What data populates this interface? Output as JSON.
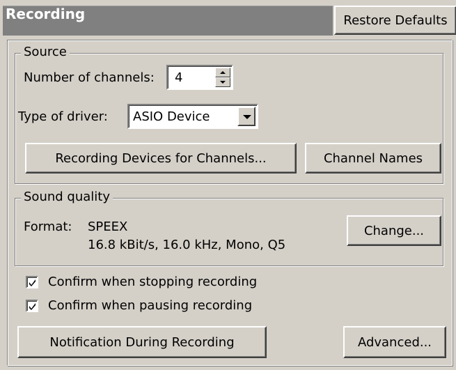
{
  "header": {
    "title": "Recording",
    "restore_defaults_label": "Restore Defaults"
  },
  "source": {
    "legend": "Source",
    "channels_label": "Number of channels:",
    "channels_value": "4",
    "driver_label": "Type of driver:",
    "driver_value": "ASIO Device",
    "recording_devices_label": "Recording Devices for Channels...",
    "channel_names_label": "Channel Names"
  },
  "sound_quality": {
    "legend": "Sound quality",
    "format_label": "Format:",
    "format_codec": "SPEEX",
    "format_details": "16.8 kBit/s, 16.0 kHz, Mono, Q5",
    "change_label": "Change..."
  },
  "options": {
    "confirm_stop_label": "Confirm when stopping recording",
    "confirm_stop_checked": true,
    "confirm_pause_label": "Confirm when pausing recording",
    "confirm_pause_checked": true
  },
  "footer": {
    "notification_label": "Notification During Recording",
    "advanced_label": "Advanced..."
  }
}
